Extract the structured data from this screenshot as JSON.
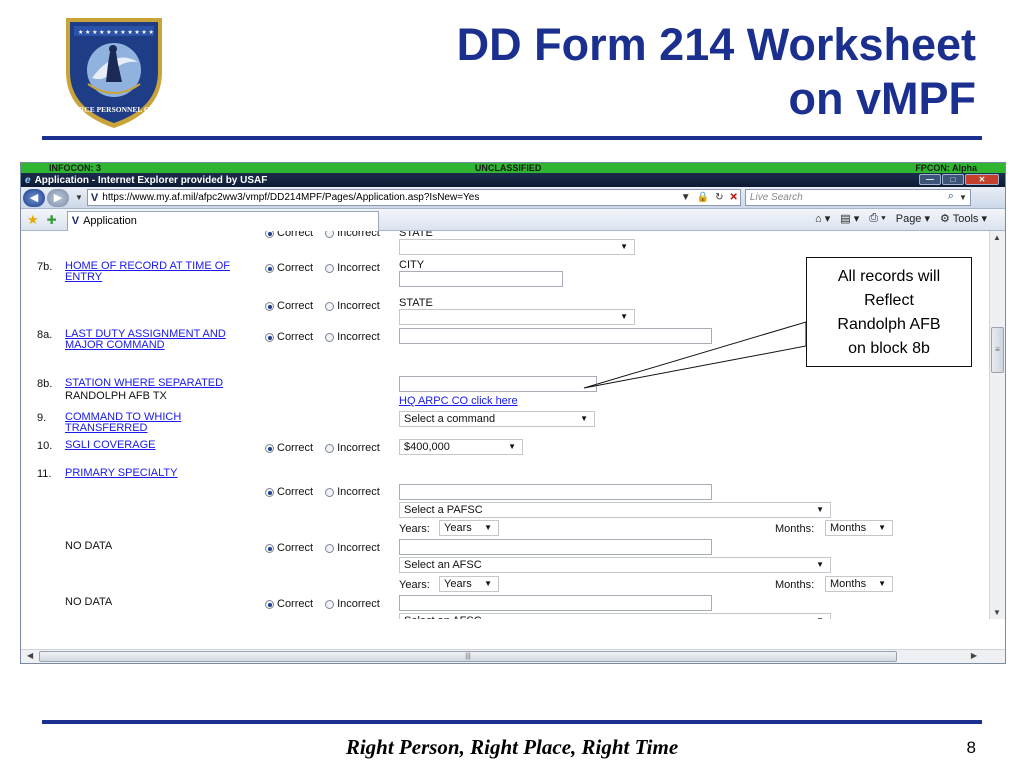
{
  "slide": {
    "title_line1": "DD Form 214 Worksheet",
    "title_line2": "on vMPF",
    "footer": "Right Person, Right Place, Right Time",
    "page_number": "8",
    "logo_text": "AIR FORCE PERSONNEL CENTER"
  },
  "callout": {
    "line1": "All records will",
    "line2": "Reflect",
    "line3": "Randolph AFB",
    "line4": "on block 8b"
  },
  "browser": {
    "infocon": "INFOCON: 3",
    "classification": "UNCLASSIFIED",
    "fpcon": "FPCON: Alpha",
    "window_title": "Application - Internet Explorer provided by USAF",
    "url": "https://www.my.af.mil/afpc2ww3/vmpf/DD214MPF/Pages/Application.asp?IsNew=Yes",
    "search_placeholder": "Live Search",
    "tab_label": "Application",
    "cmd_page": "Page",
    "cmd_tools": "Tools"
  },
  "form": {
    "correct_label": "Correct",
    "incorrect_label": "Incorrect",
    "partial_state_label": "STATE",
    "row_7b": {
      "num": "7b.",
      "label": "HOME OF RECORD AT TIME OF ENTRY",
      "city_label": "CITY",
      "state_label": "STATE"
    },
    "row_8a": {
      "num": "8a.",
      "label": "LAST DUTY ASSIGNMENT AND MAJOR COMMAND"
    },
    "row_8b": {
      "num": "8b.",
      "label": "STATION WHERE SEPARATED",
      "value": "RANDOLPH AFB TX",
      "link": "HQ ARPC CO click here"
    },
    "row_9": {
      "num": "9.",
      "label": "COMMAND TO WHICH TRANSFERRED",
      "select": "Select a command"
    },
    "row_10": {
      "num": "10.",
      "label": "SGLI COVERAGE",
      "select": "$400,000"
    },
    "row_11": {
      "num": "11.",
      "label": "PRIMARY SPECIALTY",
      "select_pafsc": "Select a PAFSC",
      "select_afsc": "Select an AFSC",
      "no_data": "NO DATA"
    },
    "years_label": "Years:",
    "years_select": "Years",
    "months_label": "Months:",
    "months_select": "Months"
  }
}
